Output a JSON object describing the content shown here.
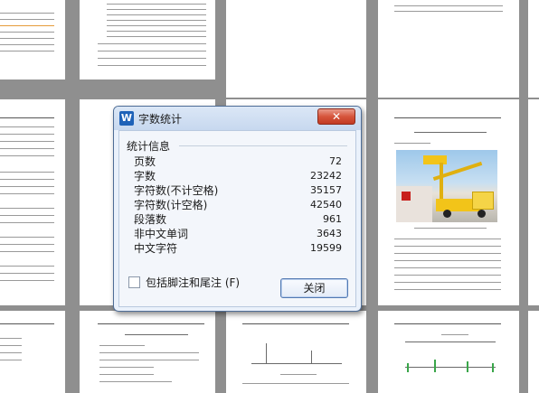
{
  "dialog": {
    "app_icon": "W",
    "title": "字数统计",
    "close_label": "✕",
    "section_title": "统计信息",
    "stats": [
      {
        "label": "页数",
        "value": "72"
      },
      {
        "label": "字数",
        "value": "23242"
      },
      {
        "label": "字符数(不计空格)",
        "value": "35157"
      },
      {
        "label": "字符数(计空格)",
        "value": "42540"
      },
      {
        "label": "段落数",
        "value": "961"
      },
      {
        "label": "非中文单词",
        "value": "3643"
      },
      {
        "label": "中文字符",
        "value": "19599"
      }
    ],
    "checkbox_label": "包括脚注和尾注 (F)",
    "checkbox_checked": false,
    "close_button_label": "关闭"
  },
  "icons": {
    "app": "wps-writer-icon",
    "close": "close-icon",
    "checkbox": "checkbox-icon"
  },
  "colors": {
    "accent": "#1e62b8",
    "close_button": "#c23a22",
    "dialog_bg": "#eaf1fb",
    "workspace": "#8f8f8f"
  }
}
